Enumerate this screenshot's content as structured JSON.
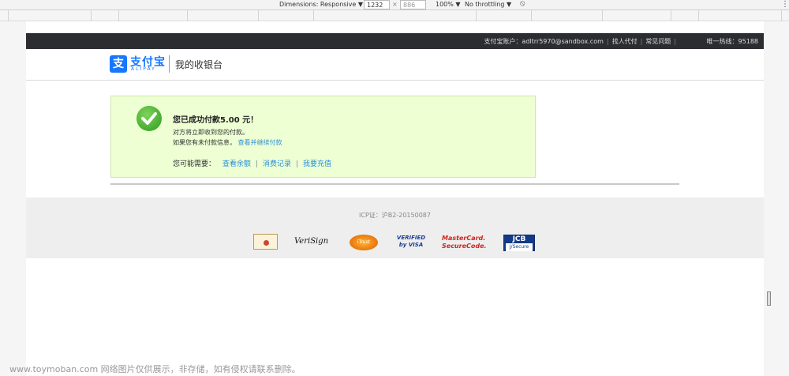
{
  "devtools": {
    "dimensions_label": "Dimensions: Responsive ▼",
    "width": "1232",
    "times": "×",
    "height": "886",
    "zoom": "100% ▼",
    "throttle": "No throttling ▼",
    "no_throttle_icon": "⃠",
    "more": "⋮"
  },
  "topbar": {
    "account": "支付宝账户：adltrr5970@sandbox.com",
    "link1": "找人代付",
    "link2": "常见问题",
    "hotline": "唯一热线：95188",
    "sep": "|"
  },
  "header": {
    "logo_mark": "支",
    "logo_text": "支付宝",
    "logo_sub": "ALIPAY",
    "cashier": "我的收银台"
  },
  "success": {
    "title": "您已成功付款5.00 元！",
    "line1": "对方将立即收到您的付款。",
    "line2_text": "如果您有未付款信息，",
    "line2_link": "查看并继续付款",
    "actions_prefix": "您可能需要：",
    "action1": "查看余额",
    "action2": "消费记录",
    "action3": "我要充值",
    "sep": "|"
  },
  "footer": {
    "icp": "ICP证：沪B2-20150087",
    "verisign_a": "Veri",
    "verisign_b": "Sign",
    "itrust": "iTrust",
    "visa_top": "VERIFIED",
    "visa_bottom": "by VISA",
    "mc_top": "MasterCard.",
    "mc_bottom": "SecureCode.",
    "jcb_top": "JCB",
    "jcb_bottom": "J/Secure"
  },
  "watermark": "www.toymoban.com 网络图片仅供展示，非存储，如有侵权请联系删除。"
}
